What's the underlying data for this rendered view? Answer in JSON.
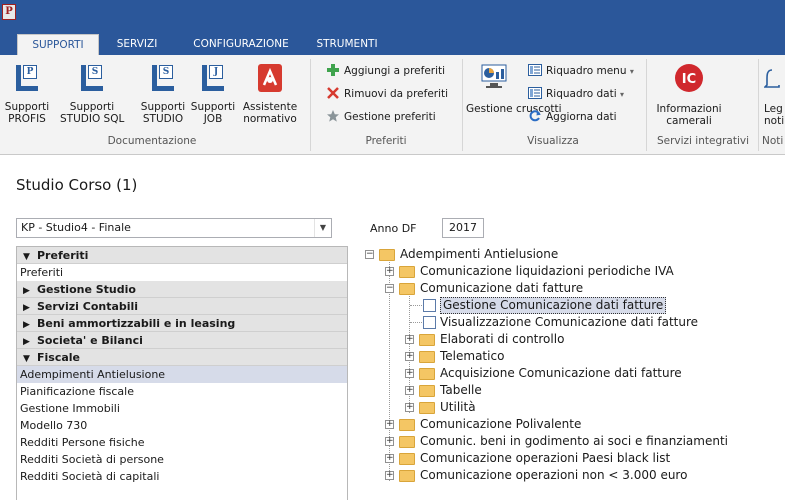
{
  "titlebar": {
    "app_icon_letter": "P"
  },
  "tabs": [
    {
      "label": "SUPPORTI",
      "active": true
    },
    {
      "label": "SERVIZI",
      "active": false
    },
    {
      "label": "CONFIGURAZIONE",
      "active": false
    },
    {
      "label": "STRUMENTI",
      "active": false
    }
  ],
  "ribbon": {
    "documentazione": {
      "group_label": "Documentazione",
      "buttons": [
        {
          "label": "Supporti\nPROFIS",
          "icon_letter": "P"
        },
        {
          "label": "Supporti\nSTUDIO SQL",
          "icon_letter": "S"
        },
        {
          "label": "Supporti\nSTUDIO",
          "icon_letter": "S"
        },
        {
          "label": "Supporti\nJOB",
          "icon_letter": "J"
        },
        {
          "label": "Assistente\nnormativo"
        }
      ]
    },
    "preferiti": {
      "group_label": "Preferiti",
      "add": "Aggiungi a preferiti",
      "remove": "Rimuovi da preferiti",
      "manage": "Gestione preferiti"
    },
    "visualizza": {
      "group_label": "Visualizza",
      "cruscotti": "Gestione\ncruscotti",
      "menu": "Riquadro menu",
      "dati": "Riquadro dati",
      "aggiorna": "Aggiorna dati"
    },
    "servizi_integrativi": {
      "group_label": "Servizi integrativi",
      "icon_text": "IC",
      "label": "Informazioni\ncamerali"
    },
    "notifiche": {
      "group_label": "Noti",
      "label": "Leg\nnoti"
    }
  },
  "page_title": "Studio Corso (1)",
  "studio_select": {
    "value": "KP - Studio4 - Finale"
  },
  "anno": {
    "label": "Anno DF",
    "value": "2017"
  },
  "left_panel": {
    "preferiti_header": "Preferiti",
    "preferiti_items": [
      "Preferiti"
    ],
    "sections": [
      "Gestione Studio",
      "Servizi Contabili",
      "Beni ammortizzabili e in leasing",
      "Societa' e Bilanci"
    ],
    "fiscale_header": "Fiscale",
    "fiscale_items": [
      "Adempimenti Antielusione",
      "Pianificazione fiscale",
      "Gestione Immobili",
      "Modello 730",
      "Redditi Persone fisiche",
      "Redditi Società di persone",
      "Redditi Società di capitali"
    ],
    "selected_item": "Adempimenti Antielusione"
  },
  "tree": {
    "root": "Adempimenti Antielusione",
    "items": [
      "Comunicazione liquidazioni periodiche IVA",
      "Comunicazione dati fatture",
      "Gestione Comunicazione dati fatture",
      "Visualizzazione Comunicazione dati fatture",
      "Elaborati di controllo",
      "Telematico",
      "Acquisizione Comunicazione dati fatture",
      "Tabelle",
      "Utilità",
      "Comunicazione Polivalente",
      "Comunic. beni in godimento ai soci e finanziamenti",
      "Comunicazione operazioni Paesi black list",
      "Comunicazione operazioni non < 3.000 euro"
    ],
    "selected": "Gestione Comunicazione dati fatture"
  }
}
